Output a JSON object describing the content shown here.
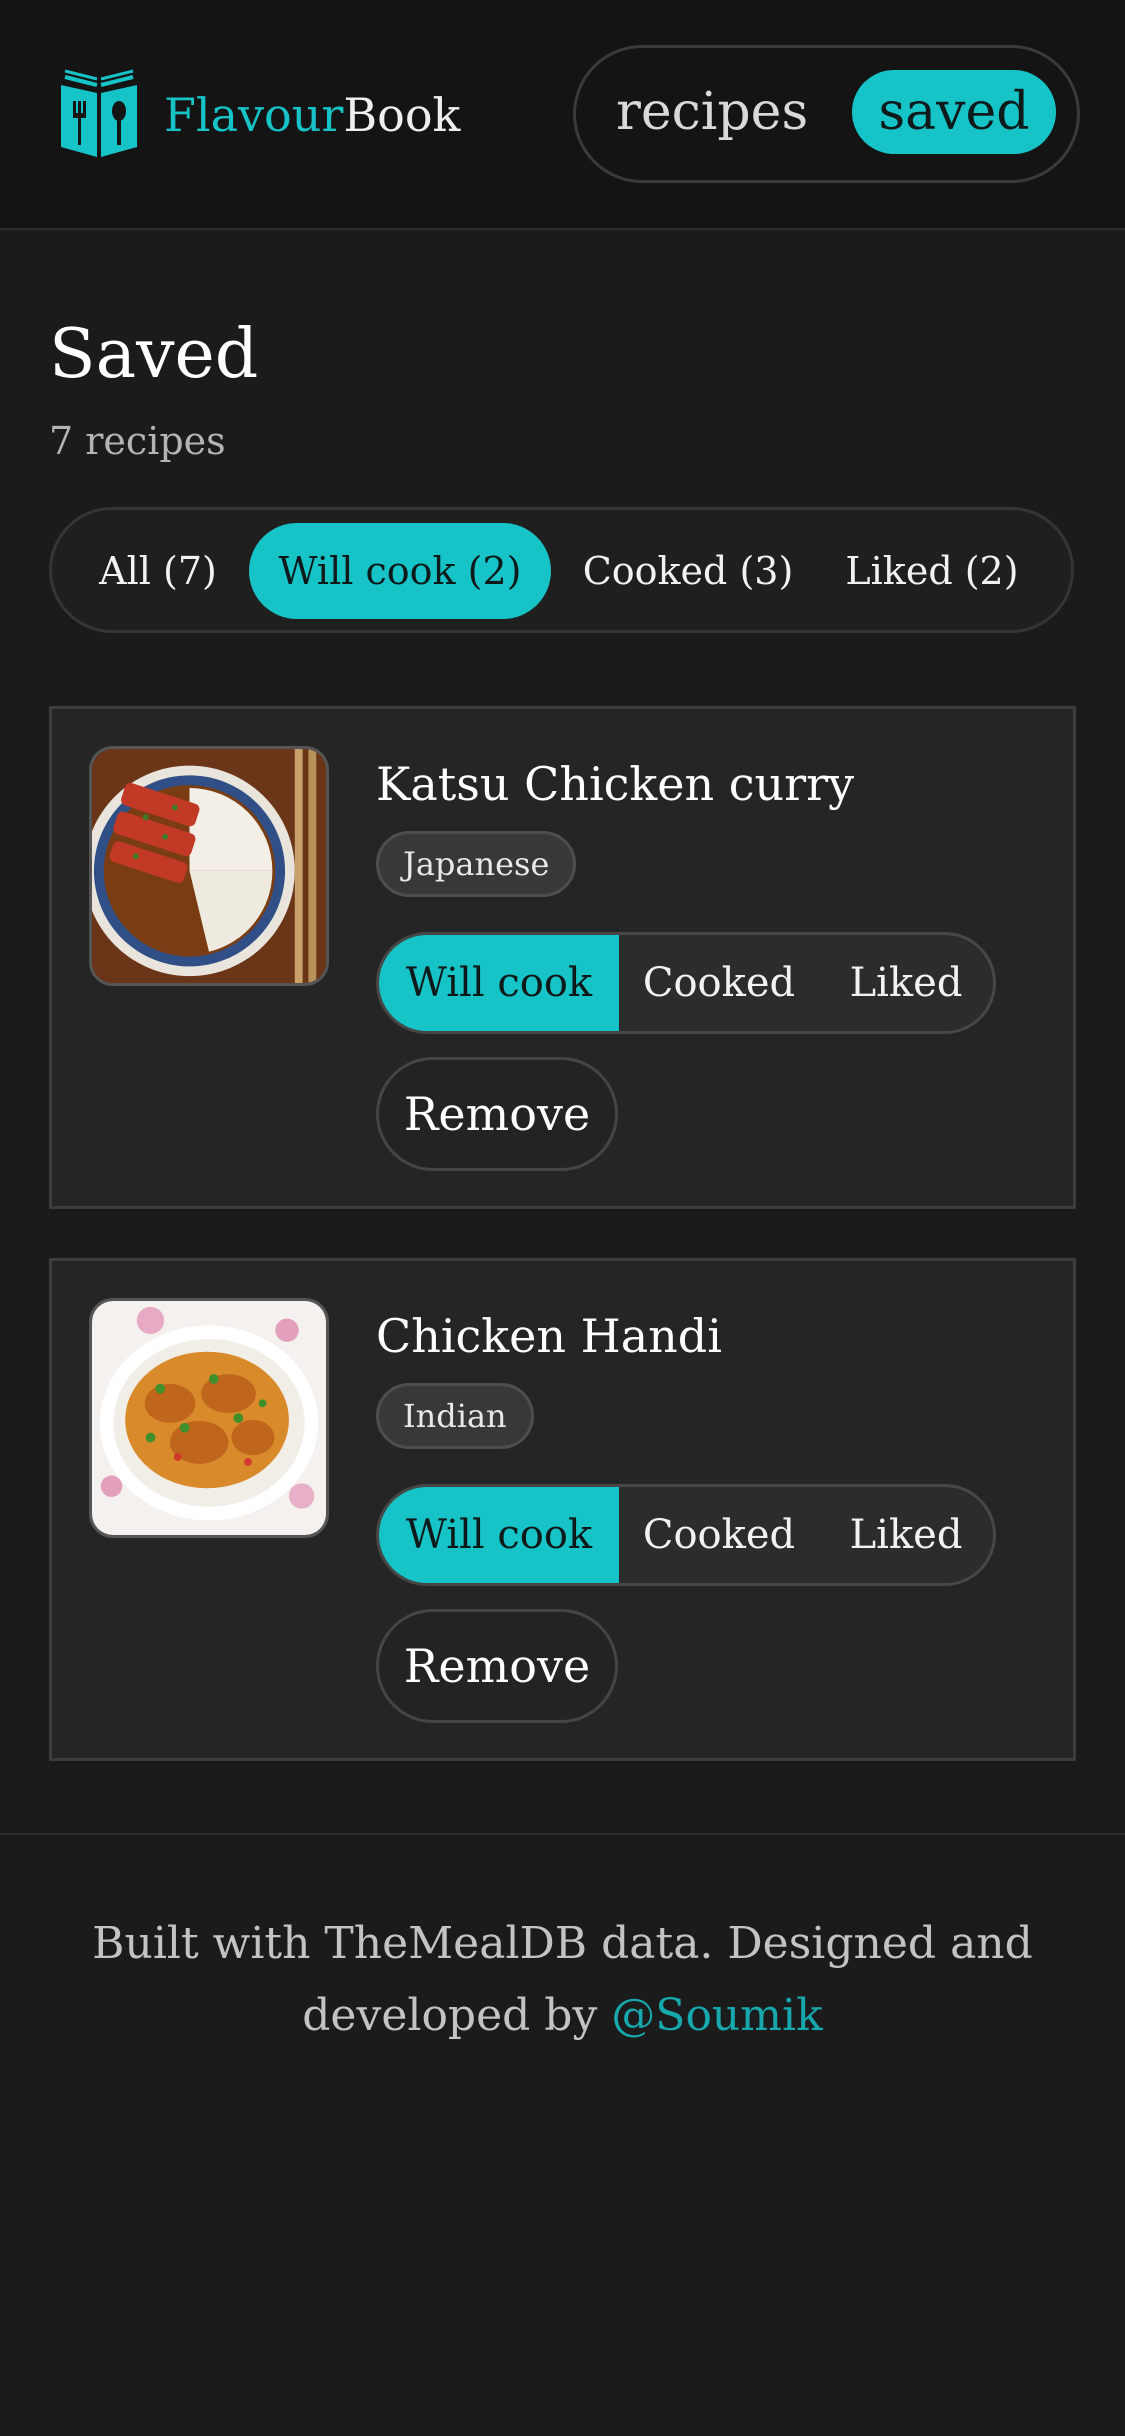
{
  "header": {
    "brand_part1": "Flavour",
    "brand_part2": "Book",
    "logo_icon": "book-with-spoon-fork-icon",
    "nav": [
      {
        "label": "recipes",
        "active": false
      },
      {
        "label": "saved",
        "active": true
      }
    ]
  },
  "page": {
    "title": "Saved",
    "count_text": "7 recipes"
  },
  "filters": [
    {
      "label": "All (7)",
      "active": false
    },
    {
      "label": "Will cook (2)",
      "active": true
    },
    {
      "label": "Cooked (3)",
      "active": false
    },
    {
      "label": "Liked (2)",
      "active": false
    }
  ],
  "recipes": [
    {
      "name": "Katsu Chicken curry",
      "cuisine": "Japanese",
      "status_options": [
        "Will cook",
        "Cooked",
        "Liked"
      ],
      "selected_status": "Will cook",
      "remove_label": "Remove"
    },
    {
      "name": "Chicken Handi",
      "cuisine": "Indian",
      "status_options": [
        "Will cook",
        "Cooked",
        "Liked"
      ],
      "selected_status": "Will cook",
      "remove_label": "Remove"
    }
  ],
  "footer": {
    "text_before": "Built with TheMealDB data. Designed and developed by ",
    "link_text": "@Soumik"
  },
  "colors": {
    "accent": "#16c4c8",
    "background": "#1b1b1b",
    "header_background": "#141414",
    "card_background": "#252525"
  }
}
